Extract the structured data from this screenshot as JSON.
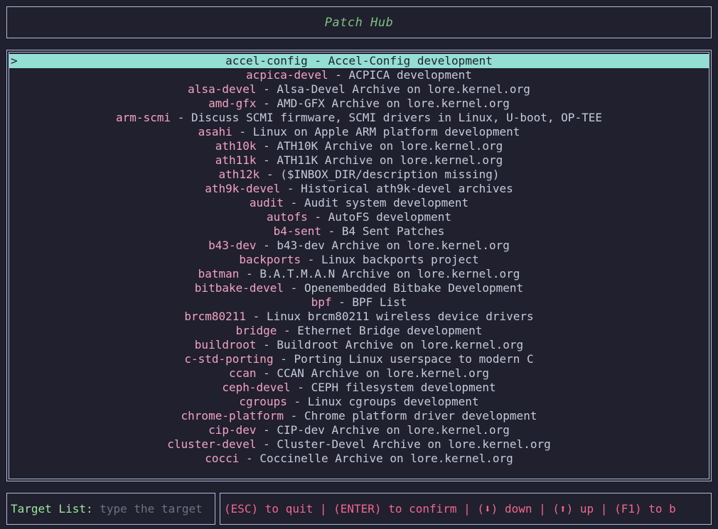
{
  "header": {
    "title": "Patch Hub"
  },
  "list": {
    "selected_index": 0,
    "cursor_glyph": ">",
    "separator": " - ",
    "items": [
      {
        "name": "accel-config",
        "description": "Accel-Config development"
      },
      {
        "name": "acpica-devel",
        "description": "ACPICA development"
      },
      {
        "name": "alsa-devel",
        "description": "Alsa-Devel Archive on lore.kernel.org"
      },
      {
        "name": "amd-gfx",
        "description": "AMD-GFX Archive on lore.kernel.org"
      },
      {
        "name": "arm-scmi",
        "description": "Discuss SCMI firmware, SCMI drivers in Linux, U-boot, OP-TEE"
      },
      {
        "name": "asahi",
        "description": "Linux on Apple ARM platform development"
      },
      {
        "name": "ath10k",
        "description": "ATH10K Archive on lore.kernel.org"
      },
      {
        "name": "ath11k",
        "description": "ATH11K Archive on lore.kernel.org"
      },
      {
        "name": "ath12k",
        "description": "($INBOX_DIR/description missing)"
      },
      {
        "name": "ath9k-devel",
        "description": "Historical ath9k-devel archives"
      },
      {
        "name": "audit",
        "description": "Audit system development"
      },
      {
        "name": "autofs",
        "description": "AutoFS development"
      },
      {
        "name": "b4-sent",
        "description": "B4 Sent Patches"
      },
      {
        "name": "b43-dev",
        "description": "b43-dev Archive on lore.kernel.org"
      },
      {
        "name": "backports",
        "description": "Linux backports project"
      },
      {
        "name": "batman",
        "description": "B.A.T.M.A.N Archive on lore.kernel.org"
      },
      {
        "name": "bitbake-devel",
        "description": "Openembedded Bitbake Development"
      },
      {
        "name": "bpf",
        "description": "BPF List"
      },
      {
        "name": "brcm80211",
        "description": "Linux brcm80211 wireless device drivers"
      },
      {
        "name": "bridge",
        "description": "Ethernet Bridge development"
      },
      {
        "name": "buildroot",
        "description": "Buildroot Archive on lore.kernel.org"
      },
      {
        "name": "c-std-porting",
        "description": "Porting Linux userspace to modern C"
      },
      {
        "name": "ccan",
        "description": "CCAN Archive on lore.kernel.org"
      },
      {
        "name": "ceph-devel",
        "description": "CEPH filesystem development"
      },
      {
        "name": "cgroups",
        "description": "Linux cgroups development"
      },
      {
        "name": "chrome-platform",
        "description": "Chrome platform driver development"
      },
      {
        "name": "cip-dev",
        "description": "CIP-dev Archive on lore.kernel.org"
      },
      {
        "name": "cluster-devel",
        "description": "Cluster-Devel Archive on lore.kernel.org"
      },
      {
        "name": "cocci",
        "description": "Coccinelle Archive on lore.kernel.org"
      }
    ]
  },
  "target_input": {
    "label": "Target List:",
    "value": "",
    "placeholder": "type the target"
  },
  "help_bar": {
    "text": "(ESC) to quit | (ENTER) to confirm | (⬇) down | (⬆) up | (F1) to b"
  },
  "colors": {
    "background": "#20202e",
    "border": "#b3bada",
    "title_green": "#7fc07f",
    "highlight_bg": "#93dfd3",
    "item_name_pink": "#f2a2c4",
    "item_desc_gray": "#c6cadb",
    "help_pink": "#f2678c",
    "label_green": "#9ee59e",
    "placeholder_gray": "#6d7384"
  }
}
